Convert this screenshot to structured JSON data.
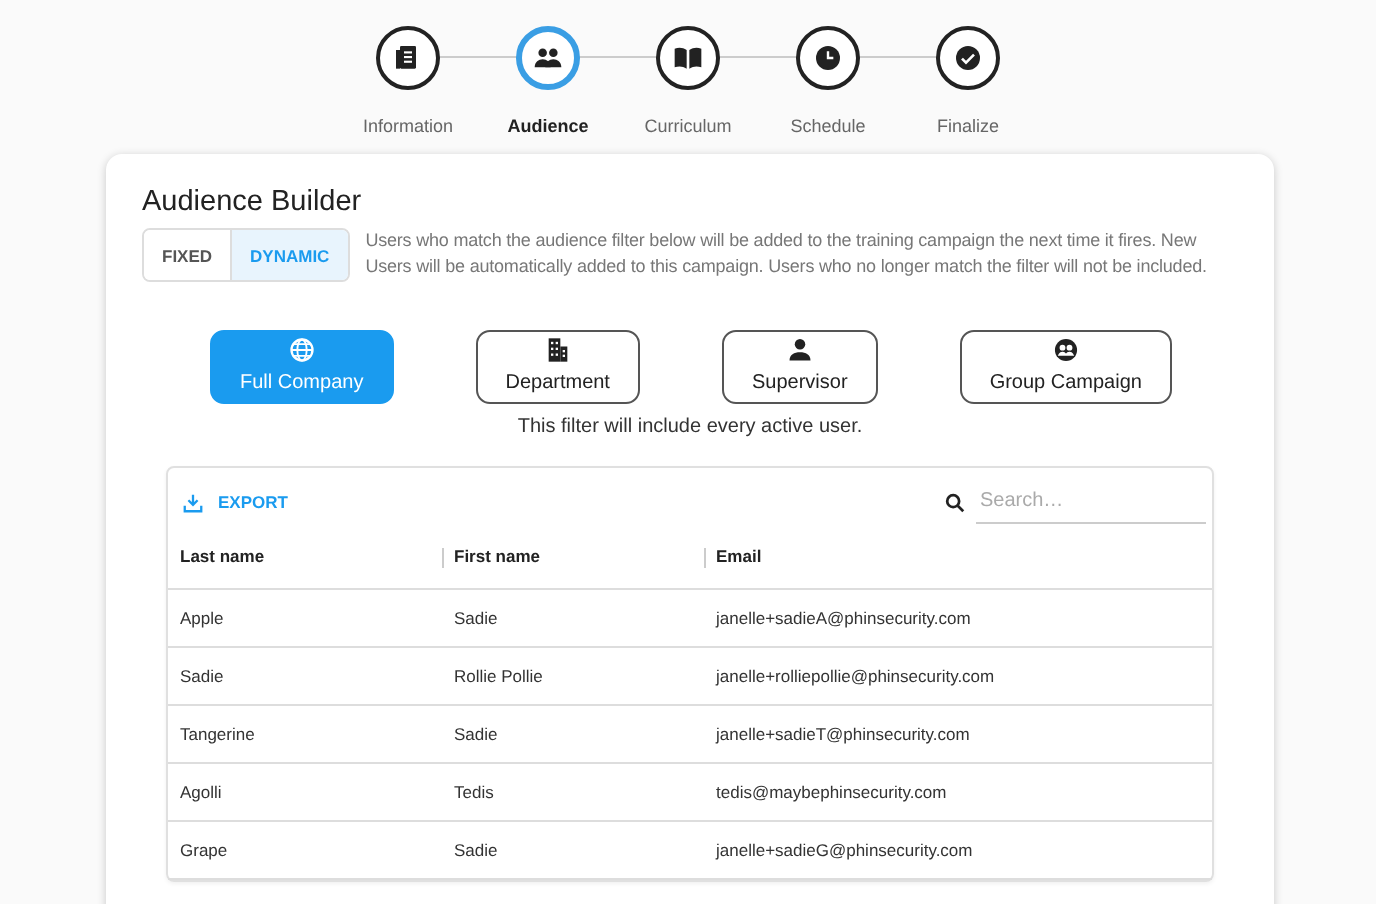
{
  "steps": [
    {
      "label": "Information",
      "kind": "document",
      "selected": false
    },
    {
      "label": "Audience",
      "kind": "people",
      "selected": true
    },
    {
      "label": "Curriculum",
      "kind": "book",
      "selected": false
    },
    {
      "label": "Schedule",
      "kind": "clock",
      "selected": false
    },
    {
      "label": "Finalize",
      "kind": "check",
      "selected": false
    }
  ],
  "builder": {
    "title": "Audience Builder",
    "mode_toggle": [
      {
        "label": "FIXED",
        "selected": false
      },
      {
        "label": "DYNAMIC",
        "selected": true
      }
    ],
    "description": "Users who match the audience filter below will be added to the training campaign the next time it fires. New Users will be automatically added to this campaign. Users who no longer match the filter will not be included.",
    "filters": [
      {
        "label": "Full Company",
        "kind": "globe",
        "selected": true
      },
      {
        "label": "Department",
        "kind": "building",
        "selected": false
      },
      {
        "label": "Supervisor",
        "kind": "person",
        "selected": false
      },
      {
        "label": "Group Campaign",
        "kind": "group",
        "selected": false
      }
    ],
    "filter_note": "This filter will include every active user."
  },
  "table": {
    "export_label": "EXPORT",
    "search": {
      "placeholder": "Search…"
    },
    "columns": [
      "Last name",
      "First name",
      "Email"
    ],
    "rows": [
      [
        "Apple",
        "Sadie",
        "janelle+sadieA@phinsecurity.com"
      ],
      [
        "Sadie",
        "Rollie Pollie",
        "janelle+rolliepollie@phinsecurity.com"
      ],
      [
        "Tangerine",
        "Sadie",
        "janelle+sadieT@phinsecurity.com"
      ],
      [
        "Agolli",
        "Tedis",
        "tedis@maybephinsecurity.com"
      ],
      [
        "Grape",
        "Sadie",
        "janelle+sadieG@phinsecurity.com"
      ]
    ]
  }
}
